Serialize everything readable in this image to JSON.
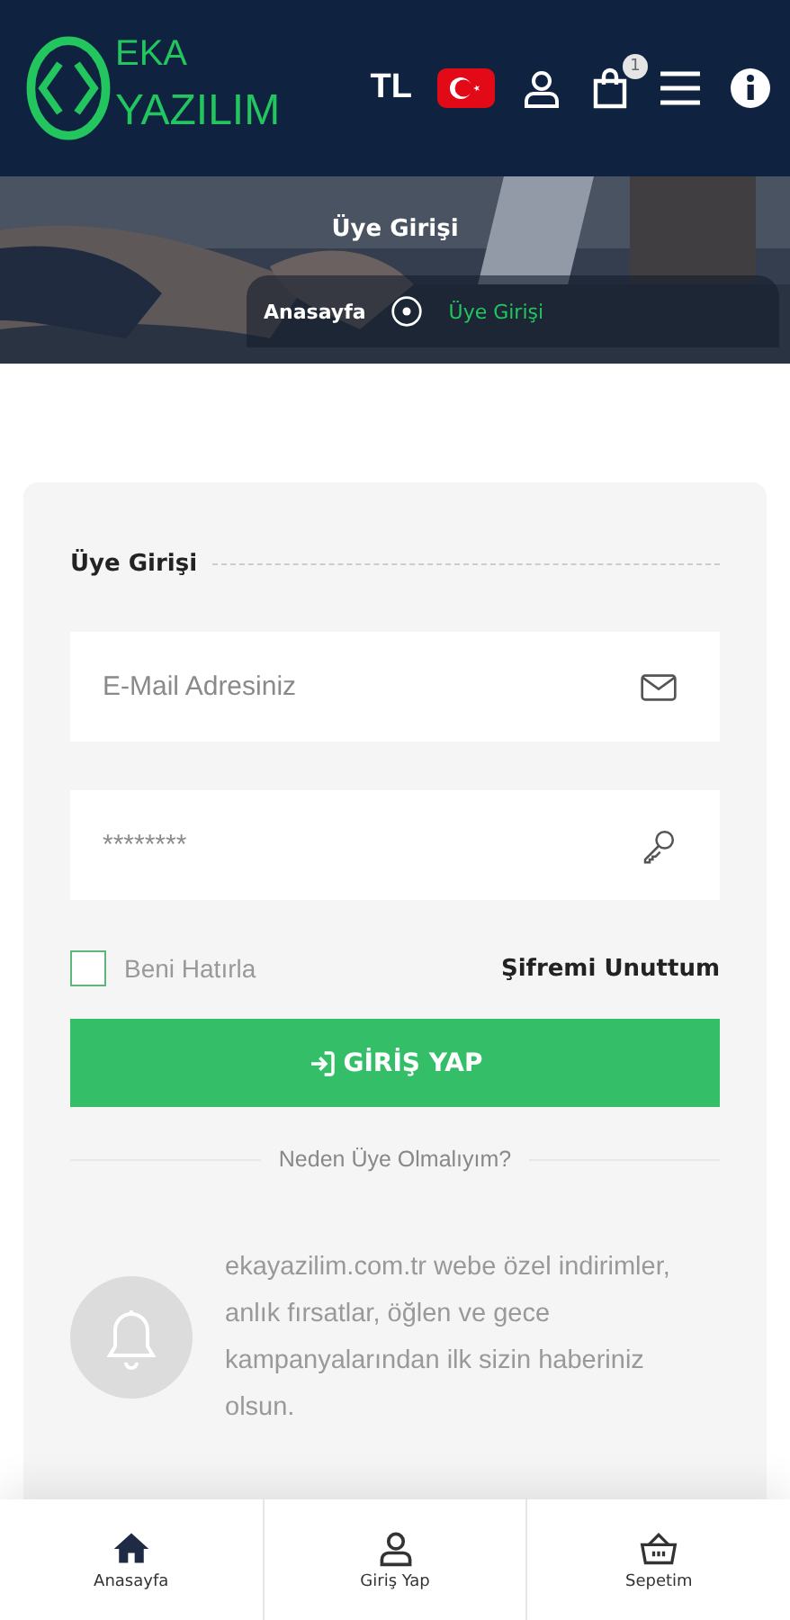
{
  "header": {
    "logo": [
      "EKA",
      "YAZILIM"
    ],
    "currency": "TL",
    "cart_count": "1"
  },
  "banner": {
    "title": "Üye Girişi",
    "breadcrumb": [
      {
        "label": "Anasayfa",
        "selected": false
      },
      {
        "label": "Üye Girişi",
        "selected": true
      }
    ]
  },
  "login": {
    "title": "Üye Girişi",
    "email": {
      "placeholder": "E-Mail Adresiniz"
    },
    "password": {
      "placeholder": "********"
    },
    "remember": {
      "label": "Beni Hatırla",
      "checked": false
    },
    "forgot": "Şifremi Unuttum",
    "submit": "GİRİŞ YAP",
    "divider": "Neden Üye Olmalıyım?",
    "info": "ekayazilim.com.tr webe özel indirimler, anlık fırsatlar, öğlen ve gece kampanyalarından ilk sizin haberiniz olsun."
  },
  "bottom_nav": [
    {
      "kind": "home",
      "label": "Anasayfa"
    },
    {
      "kind": "user",
      "label": "Giriş Yap"
    },
    {
      "kind": "basket",
      "label": "Sepetim"
    }
  ]
}
